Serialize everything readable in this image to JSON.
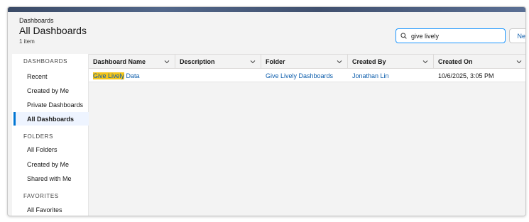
{
  "header": {
    "breadcrumb": "Dashboards",
    "title": "All Dashboards",
    "count": "1 item",
    "search_value": "give lively",
    "new_label": "New"
  },
  "sidebar": {
    "dashboards_heading": "DASHBOARDS",
    "dashboard_items": [
      {
        "label": "Recent"
      },
      {
        "label": "Created by Me"
      },
      {
        "label": "Private Dashboards"
      },
      {
        "label": "All Dashboards",
        "active": true
      }
    ],
    "folders_heading": "FOLDERS",
    "folder_items": [
      {
        "label": "All Folders"
      },
      {
        "label": "Created by Me"
      },
      {
        "label": "Shared with Me"
      }
    ],
    "favorites_heading": "FAVORITES",
    "favorite_items": [
      {
        "label": "All Favorites"
      }
    ]
  },
  "table": {
    "columns": [
      "Dashboard Name",
      "Description",
      "Folder",
      "Created By",
      "Created On"
    ],
    "rows": [
      {
        "name_highlight": "Give Lively",
        "name_rest": " Data",
        "description": "",
        "folder": "Give Lively Dashboards",
        "created_by": "Jonathan Lin",
        "created_on": "10/6/2025, 3:05 PM"
      }
    ]
  },
  "colors": {
    "link": "#0b5cab",
    "highlight": "#f5c518",
    "active_accent": "#0176d3"
  }
}
